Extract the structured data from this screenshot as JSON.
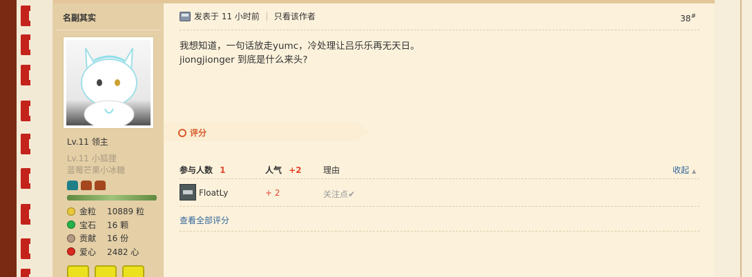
{
  "author": {
    "name": "名副其实",
    "level_main": "Lv.11 领主",
    "level_sub": "Lv.11 小狐狸",
    "level_sub2": "蓝莓芒果小冰糖",
    "stats": [
      {
        "label": "金粒",
        "value": "10889 粒",
        "color": "#e7c83a"
      },
      {
        "label": "宝石",
        "value": "16 颗",
        "color": "#25b24a"
      },
      {
        "label": "贡献",
        "value": "16 份",
        "color": "#b09a85"
      },
      {
        "label": "爱心",
        "value": "2482 心",
        "color": "#d9281f"
      }
    ]
  },
  "meta": {
    "posted": "发表于 11 小时前",
    "only_author": "只看该作者",
    "floor": "38",
    "floor_mark": "#"
  },
  "content": {
    "line1": "我想知道，一句话放走yumc，冷处理让吕乐乐再无天日。",
    "line2": "jiongjionger 到底是什么来头?"
  },
  "rating": {
    "label": "评分",
    "participants_label": "参与人数",
    "participants_count": "1",
    "popularity_label": "人气",
    "popularity_total": "+2",
    "reason_label": "理由",
    "collapse_label": "收起",
    "rows": [
      {
        "user": "FloatLy",
        "score": "+ 2",
        "reason": "关注点✔"
      }
    ],
    "view_all": "查看全部评分"
  }
}
